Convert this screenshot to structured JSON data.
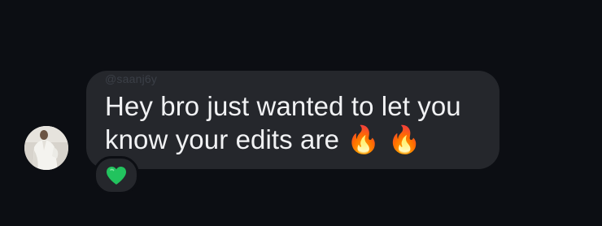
{
  "message": {
    "sender": "@saanj6y",
    "text": "Hey bro just wanted to let you know your edits are 🔥 🔥",
    "reaction": {
      "emoji": "💚",
      "icon": "green-heart-icon"
    }
  },
  "avatar": {
    "icon": "user-avatar-photo"
  },
  "colors": {
    "background": "#0c0e13",
    "bubble": "#25272c",
    "text": "#f1f2f4",
    "username": "#3b3f47",
    "reaction_heart": "#22c35e",
    "flame_outer": "#f25a1a",
    "flame_inner": "#ffc533"
  }
}
